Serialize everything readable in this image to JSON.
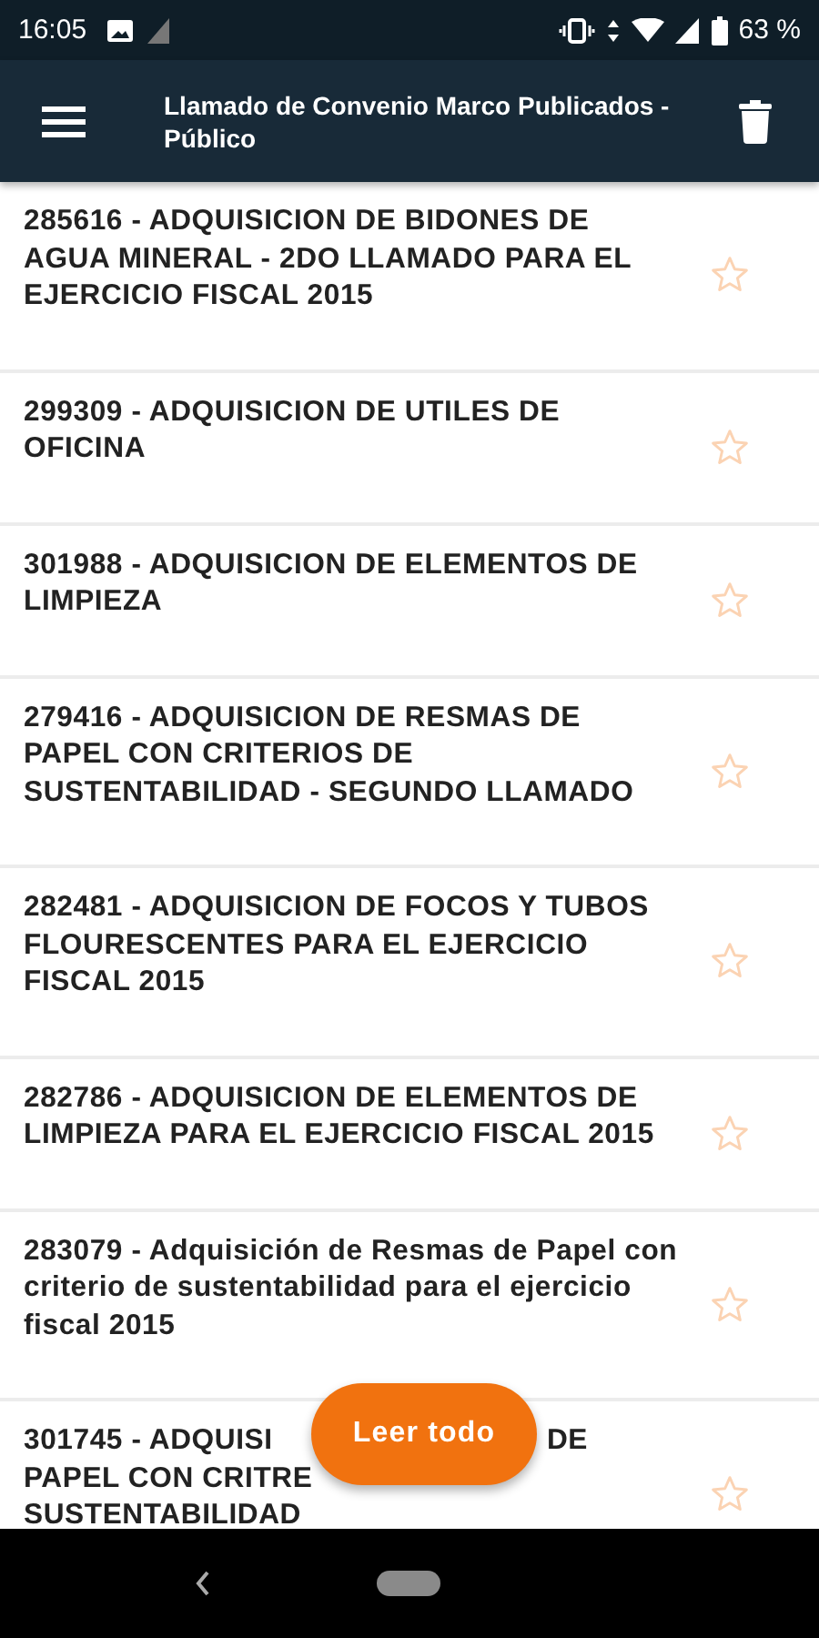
{
  "status_bar": {
    "time": "16:05",
    "battery": "63 %"
  },
  "app_bar": {
    "title": "Llamado de Convenio Marco Publicados - Público"
  },
  "items": [
    {
      "title": "285616 - ADQUISICION DE BIDONES DE AGUA MINERAL - 2DO LLAMADO PARA EL EJERCICIO FISCAL 2015",
      "starred": false
    },
    {
      "title": "299309 - ADQUISICION DE UTILES DE OFICINA",
      "starred": false
    },
    {
      "title": "301988 - ADQUISICION DE ELEMENTOS DE LIMPIEZA",
      "starred": false
    },
    {
      "title": "279416 - ADQUISICION DE RESMAS DE PAPEL CON CRITERIOS DE SUSTENTABILIDAD - SEGUNDO LLAMADO",
      "starred": false
    },
    {
      "title": "282481 - ADQUISICION DE FOCOS Y TUBOS FLOURESCENTES PARA EL EJERCICIO FISCAL 2015",
      "starred": false
    },
    {
      "title": "282786 - ADQUISICION DE ELEMENTOS DE LIMPIEZA PARA EL EJERCICIO FISCAL 2015",
      "starred": false
    },
    {
      "title": "283079 - Adquisición de Resmas de Papel con criterio de sustentabilidad para el ejercicio fiscal 2015",
      "starred": false
    },
    {
      "lines": [
        [
          "301745 - ADQUISI",
          "DE"
        ],
        [
          "PAPEL CON CRITRE"
        ],
        [
          "SUSTENTABILIDAD"
        ]
      ],
      "starred": false
    }
  ],
  "fab": {
    "label": "Leer todo"
  }
}
